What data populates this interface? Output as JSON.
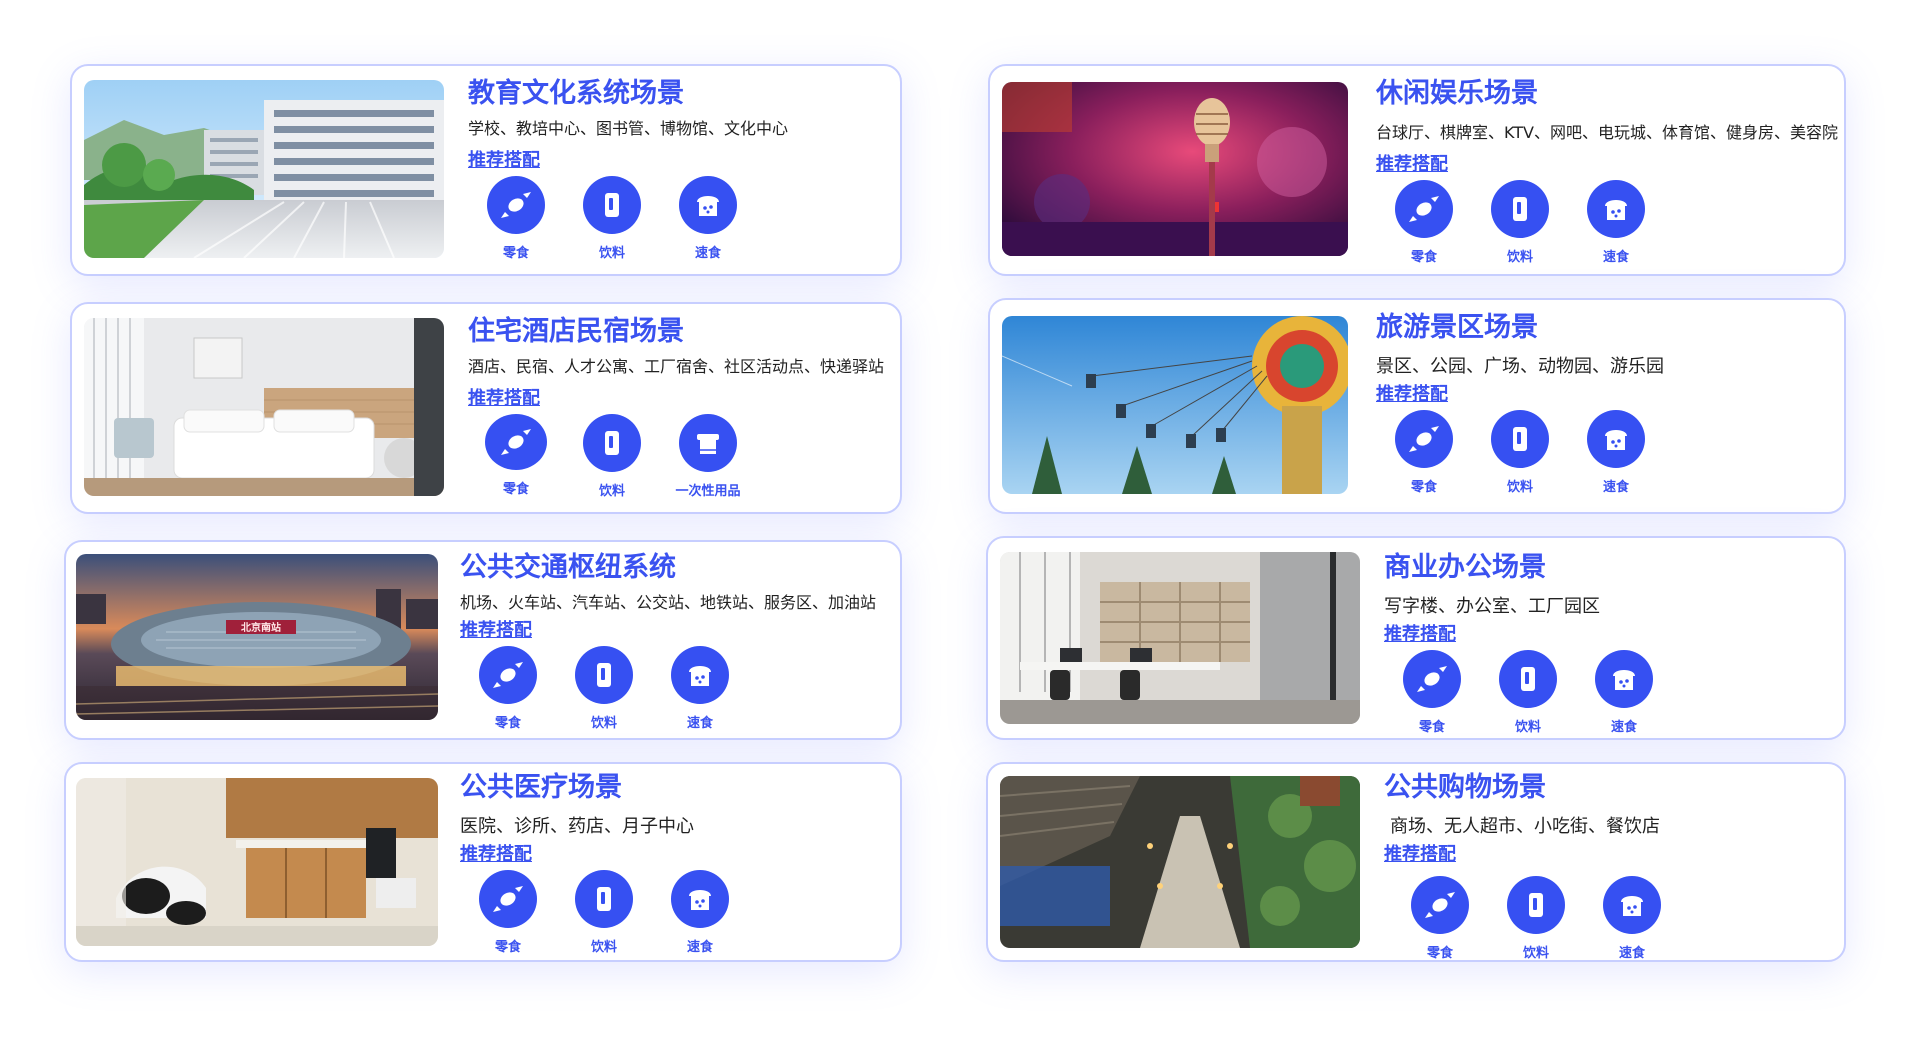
{
  "recommend_label": "推荐搭配",
  "scenes": [
    {
      "id": "education",
      "title": "教育文化系统场景",
      "desc": "学校、教培中心、图书管、博物馆、文化中心",
      "image": "campus-photo",
      "items": [
        {
          "label": "零食",
          "icon": "candy-icon"
        },
        {
          "label": "饮料",
          "icon": "drink-can-icon"
        },
        {
          "label": "速食",
          "icon": "bread-icon"
        }
      ]
    },
    {
      "id": "leisure",
      "title": "休闲娱乐场景",
      "desc": "台球厅、棋牌室、KTV、网吧、电玩城、体育馆、健身房、美容院",
      "image": "microphone-stage-photo",
      "items": [
        {
          "label": "零食",
          "icon": "candy-icon"
        },
        {
          "label": "饮料",
          "icon": "drink-can-icon"
        },
        {
          "label": "速食",
          "icon": "bread-icon"
        }
      ]
    },
    {
      "id": "hotel",
      "title": "住宅酒店民宿场景",
      "desc": "酒店、民宿、人才公寓、工厂宿舍、社区活动点、快递驿站",
      "image": "hotel-room-photo",
      "items": [
        {
          "label": "零食",
          "icon": "candy-icon"
        },
        {
          "label": "饮料",
          "icon": "drink-can-icon"
        },
        {
          "label": "一次性用品",
          "icon": "towel-icon"
        }
      ]
    },
    {
      "id": "tourism",
      "title": "旅游景区场景",
      "desc": "景区、公园、广场、动物园、游乐园",
      "image": "swing-ride-photo",
      "items": [
        {
          "label": "零食",
          "icon": "candy-icon"
        },
        {
          "label": "饮料",
          "icon": "drink-can-icon"
        },
        {
          "label": "速食",
          "icon": "bread-icon"
        }
      ]
    },
    {
      "id": "transport",
      "title": "公共交通枢纽系统",
      "desc": "机场、火车站、汽车站、公交站、地铁站、服务区、加油站",
      "image": "railway-station-photo",
      "station_sign": "北京南站",
      "items": [
        {
          "label": "零食",
          "icon": "candy-icon"
        },
        {
          "label": "饮料",
          "icon": "drink-can-icon"
        },
        {
          "label": "速食",
          "icon": "bread-icon"
        }
      ]
    },
    {
      "id": "office",
      "title": "商业办公场景",
      "desc": "写字楼、办公室、工厂园区",
      "image": "office-photo",
      "items": [
        {
          "label": "零食",
          "icon": "candy-icon"
        },
        {
          "label": "饮料",
          "icon": "drink-can-icon"
        },
        {
          "label": "速食",
          "icon": "bread-icon"
        }
      ]
    },
    {
      "id": "medical",
      "title": "公共医疗场景",
      "desc": "医院、诊所、药店、月子中心",
      "image": "dental-clinic-photo",
      "items": [
        {
          "label": "零食",
          "icon": "candy-icon"
        },
        {
          "label": "饮料",
          "icon": "drink-can-icon"
        },
        {
          "label": "速食",
          "icon": "bread-icon"
        }
      ]
    },
    {
      "id": "shopping",
      "title": "公共购物场景",
      "desc": "商场、无人超市、小吃街、餐饮店",
      "image": "shopping-street-photo",
      "items": [
        {
          "label": "零食",
          "icon": "candy-icon"
        },
        {
          "label": "饮料",
          "icon": "drink-can-icon"
        },
        {
          "label": "速食",
          "icon": "bread-icon"
        }
      ]
    }
  ]
}
